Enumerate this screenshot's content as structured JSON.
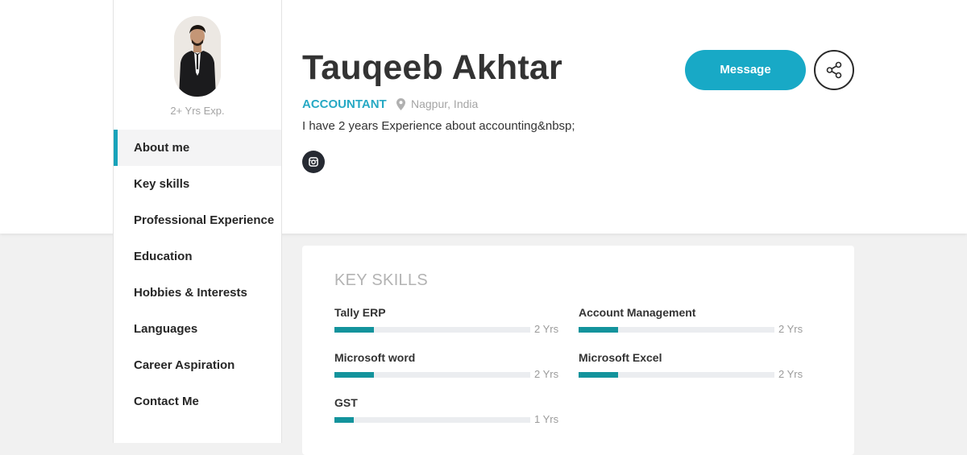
{
  "profile": {
    "name": "Tauqeeb Akhtar",
    "role": "ACCOUNTANT",
    "location": "Nagpur, India",
    "experience": "2+ Yrs Exp.",
    "about": "I have 2 years Experience about accounting&nbsp;"
  },
  "sidebar": {
    "items": [
      {
        "label": "About me"
      },
      {
        "label": "Key skills"
      },
      {
        "label": "Professional Experience"
      },
      {
        "label": "Education"
      },
      {
        "label": "Hobbies & Interests"
      },
      {
        "label": "Languages"
      },
      {
        "label": "Career Aspiration"
      },
      {
        "label": "Contact Me"
      }
    ]
  },
  "actions": {
    "message_label": "Message"
  },
  "key_skills": {
    "title": "KEY SKILLS",
    "items": [
      {
        "name": "Tally ERP",
        "years": "2 Yrs",
        "level": 0.2
      },
      {
        "name": "Account Management",
        "years": "2 Yrs",
        "level": 0.2
      },
      {
        "name": "Microsoft word",
        "years": "2 Yrs",
        "level": 0.2
      },
      {
        "name": "Microsoft Excel",
        "years": "2 Yrs",
        "level": 0.2
      },
      {
        "name": "GST",
        "years": "1 Yrs",
        "level": 0.1
      }
    ]
  },
  "colors": {
    "accent": "#18a9c6",
    "skill_fill": "#13939c",
    "active_nav_border": "#18a3ba"
  },
  "icons": {
    "location": "map-pin-icon",
    "social": "instagram-icon",
    "share": "share-icon"
  }
}
